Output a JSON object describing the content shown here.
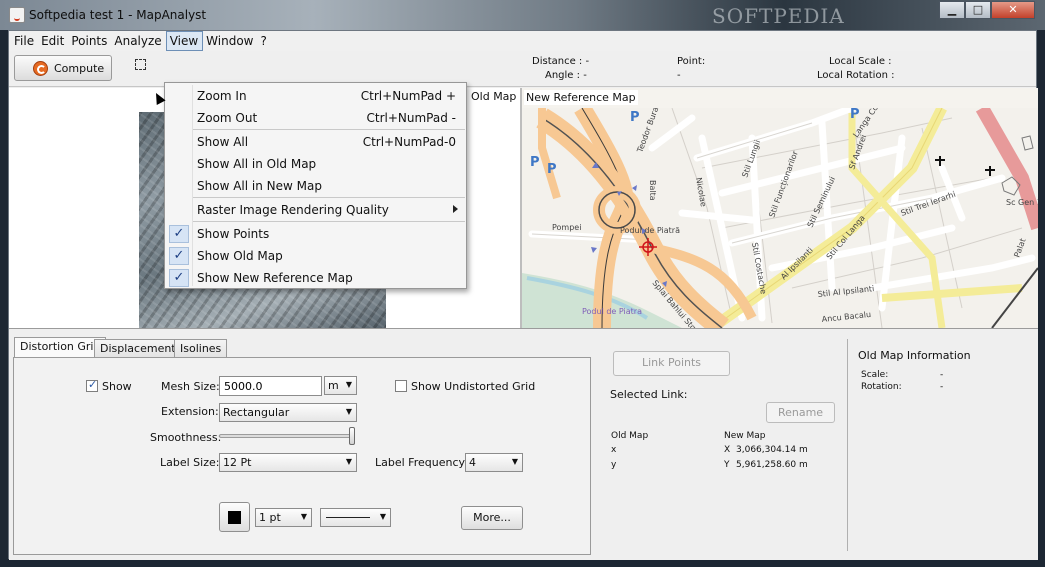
{
  "window": {
    "title": "Softpedia test 1 - MapAnalyst",
    "watermark": "SOFTPEDIA",
    "minimize_glyph": "▁",
    "maximize_glyph": "□",
    "close_glyph": "✕"
  },
  "menubar": [
    "File",
    "Edit",
    "Points",
    "Analyze",
    "View",
    "Window",
    "?"
  ],
  "toolbar": {
    "compute_label": "Compute",
    "distance_label": "Distance :",
    "distance_value": "-",
    "angle_label": "Angle :",
    "angle_value": "-",
    "point_label": "Point:",
    "point_value": "-",
    "local_scale_label": "Local Scale :",
    "local_rotation_label": "Local Rotation :"
  },
  "maps": {
    "old_map_label": "Old Map",
    "new_map_label": "New Reference Map",
    "street_labels": [
      "Pompei",
      "Podul de Piatră",
      "Podul de Piatra",
      "Splai Bahlui Stg",
      "Stil Lungii",
      "Stil Funcționarilor",
      "Stil Seminului",
      "Stil Costache",
      "Al Ipsilanti",
      "Stil Col Langa",
      "Stil Trei Ierarhi",
      "Sf Andrei",
      "Langa Col",
      "Sc Gen 1 Gh Asachi",
      "Palat",
      "Stil Al Ipsilanti",
      "Ancu Bacalu",
      "Balta",
      "Teodor Burada",
      "Nicolae"
    ]
  },
  "view_menu": {
    "items": [
      {
        "label": "Zoom In",
        "shortcut": "Ctrl+NumPad +"
      },
      {
        "label": "Zoom Out",
        "shortcut": "Ctrl+NumPad -"
      },
      {
        "label": "Show All",
        "shortcut": "Ctrl+NumPad-0"
      },
      {
        "label": "Show All in Old Map",
        "shortcut": ""
      },
      {
        "label": "Show All in New Map",
        "shortcut": ""
      },
      {
        "label": "Raster Image Rendering Quality",
        "shortcut": ""
      },
      {
        "label": "Show Points",
        "shortcut": "",
        "checked": true
      },
      {
        "label": "Show Old Map",
        "shortcut": "",
        "checked": true
      },
      {
        "label": "Show New Reference Map",
        "shortcut": "",
        "checked": true
      }
    ],
    "check_glyph": "✓"
  },
  "tabs": [
    "Distortion Grid",
    "Displacements",
    "Isolines"
  ],
  "distortion_grid": {
    "show_label": "Show",
    "show_checked": true,
    "mesh_size_label": "Mesh Size:",
    "mesh_size_value": "5000.0",
    "mesh_unit": "m",
    "show_undistorted_label": "Show Undistorted Grid",
    "show_undistorted_checked": false,
    "extension_label": "Extension:",
    "extension_value": "Rectangular",
    "smoothness_label": "Smoothness:",
    "smoothness_level": 1.0,
    "label_size_label": "Label Size:",
    "label_size_value": "12 Pt",
    "label_frequency_label": "Label Frequency:",
    "label_frequency_value": "4",
    "line_width_value": "1 pt",
    "more_label": "More...",
    "line_color": "#000000"
  },
  "link_panel": {
    "link_points_label": "Link Points",
    "selected_link_label": "Selected Link:",
    "rename_label": "Rename",
    "old_map_label": "Old Map",
    "new_map_label": "New Map",
    "x_label": "x",
    "y_label": "y",
    "new_x_label": "X",
    "new_y_label": "Y",
    "new_x_value": "3,066,304.14 m",
    "new_y_value": "5,961,258.60 m"
  },
  "old_map_info": {
    "title": "Old Map Information",
    "scale_label": "Scale:",
    "scale_value": "-",
    "rotation_label": "Rotation:",
    "rotation_value": "-"
  },
  "colors": {
    "menu_highlight": "#dbe7f4",
    "road_primary": "#f7c893",
    "road_secondary": "#f4ec98",
    "road_major": "#e79a9a",
    "marker": "#d0141a"
  }
}
